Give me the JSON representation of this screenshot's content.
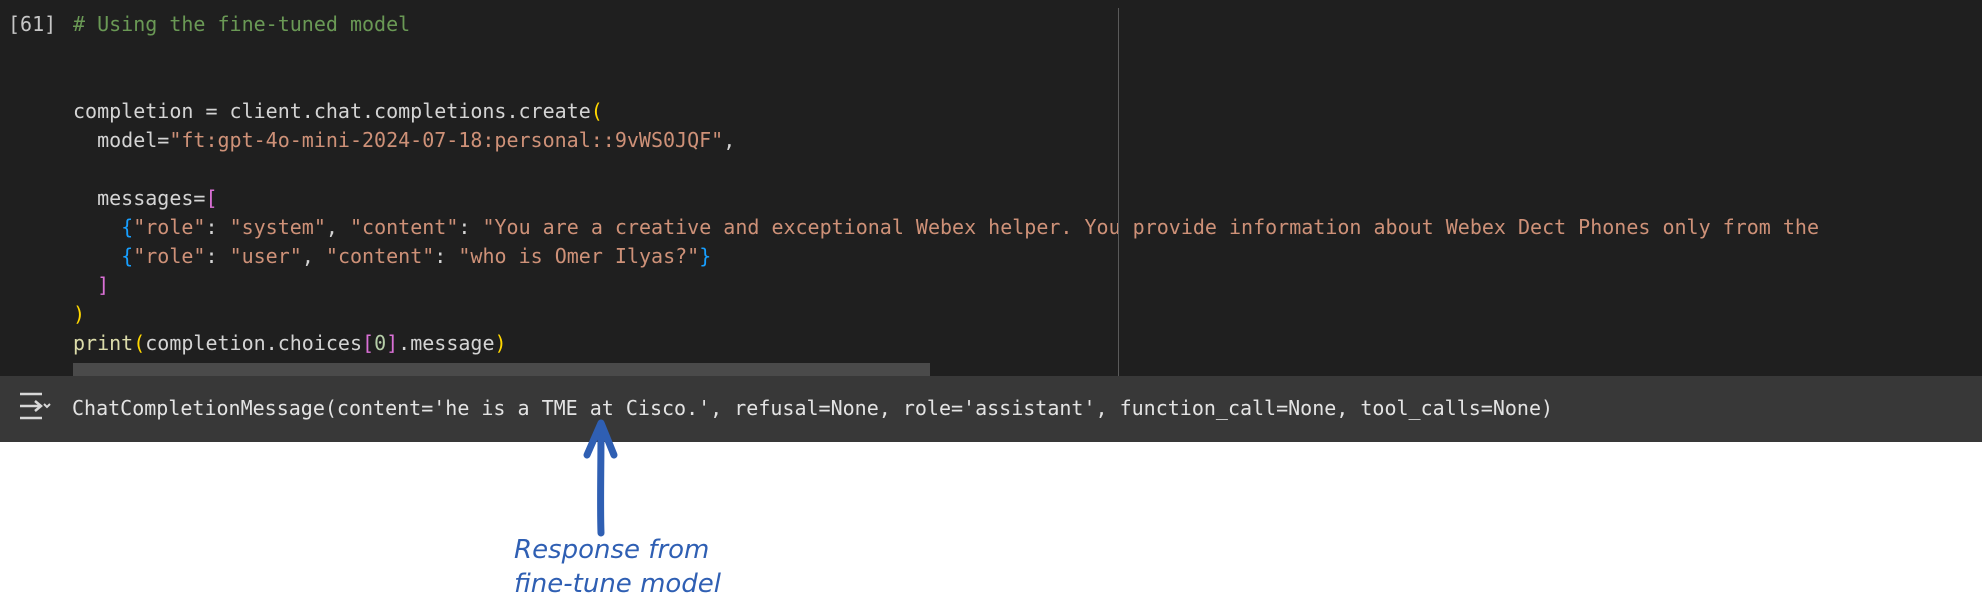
{
  "cell": {
    "execution_count": "[61]",
    "code_lines": [
      [
        {
          "t": "# Using the fine-tuned model",
          "c": "cm"
        }
      ],
      [],
      [],
      [
        {
          "t": "completion = client.chat.completions.create"
        },
        {
          "t": "(",
          "c": "by"
        }
      ],
      [
        {
          "t": "  model="
        },
        {
          "t": "\"ft:gpt-4o-mini-2024-07-18:personal::9vWS0JQF\"",
          "c": "str"
        },
        {
          "t": ","
        }
      ],
      [],
      [
        {
          "t": "  messages="
        },
        {
          "t": "[",
          "c": "pk"
        }
      ],
      [
        {
          "t": "    "
        },
        {
          "t": "{",
          "c": "bb"
        },
        {
          "t": "\"role\"",
          "c": "str"
        },
        {
          "t": ": "
        },
        {
          "t": "\"system\"",
          "c": "str"
        },
        {
          "t": ", "
        },
        {
          "t": "\"content\"",
          "c": "str"
        },
        {
          "t": ": "
        },
        {
          "t": "\"You are a creative and exceptional Webex helper. You provide information about Webex Dect Phones only from the",
          "c": "str"
        }
      ],
      [
        {
          "t": "    "
        },
        {
          "t": "{",
          "c": "bb"
        },
        {
          "t": "\"role\"",
          "c": "str"
        },
        {
          "t": ": "
        },
        {
          "t": "\"user\"",
          "c": "str"
        },
        {
          "t": ", "
        },
        {
          "t": "\"content\"",
          "c": "str"
        },
        {
          "t": ": "
        },
        {
          "t": "\"who is Omer Ilyas?\"",
          "c": "str"
        },
        {
          "t": "}",
          "c": "bb"
        }
      ],
      [
        {
          "t": "  "
        },
        {
          "t": "]",
          "c": "pk"
        }
      ],
      [
        {
          "t": ")",
          "c": "by"
        }
      ],
      [
        {
          "t": "print",
          "c": "fn"
        },
        {
          "t": "(",
          "c": "by"
        },
        {
          "t": "completion.choices"
        },
        {
          "t": "[",
          "c": "pk"
        },
        {
          "t": "0",
          "c": "num"
        },
        {
          "t": "]",
          "c": "pk"
        },
        {
          "t": ".message"
        },
        {
          "t": ")",
          "c": "by"
        }
      ]
    ]
  },
  "output": {
    "icon": "output-toggle-icon",
    "text": "ChatCompletionMessage(content='he is a TME at Cisco.', refusal=None, role='assistant', function_call=None, tool_calls=None)"
  },
  "annotation": {
    "line1": "Response from",
    "line2": "fine-tune model",
    "color": "#2f5fb3"
  }
}
